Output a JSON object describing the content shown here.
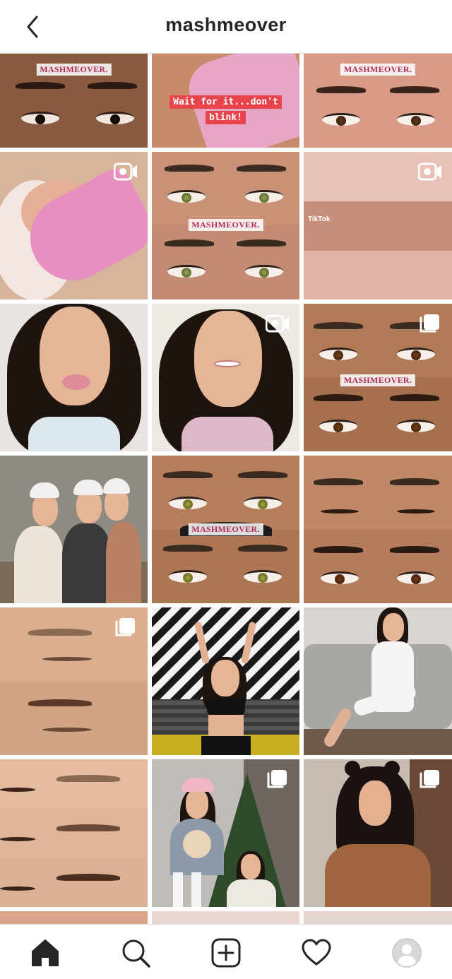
{
  "header": {
    "title": "mashmeover",
    "back_icon": "chevron-left-icon"
  },
  "watermark_text": "MASHMEOVER.",
  "grid": {
    "posts": [
      {
        "name": "post-1",
        "type": "photo",
        "watermark": true
      },
      {
        "name": "post-2",
        "type": "photo",
        "caption": "Wait for it...don't blink!"
      },
      {
        "name": "post-3",
        "type": "photo",
        "watermark": true
      },
      {
        "name": "post-4",
        "type": "video",
        "badge_icon": "video-camera-icon"
      },
      {
        "name": "post-5",
        "type": "photo",
        "watermark": true
      },
      {
        "name": "post-6",
        "type": "video",
        "badge_icon": "video-camera-icon",
        "overlay_text": "TikTok"
      },
      {
        "name": "post-7",
        "type": "photo"
      },
      {
        "name": "post-8",
        "type": "video",
        "badge_icon": "video-camera-icon"
      },
      {
        "name": "post-9",
        "type": "carousel",
        "badge_icon": "carousel-icon",
        "watermark": true
      },
      {
        "name": "post-10",
        "type": "photo"
      },
      {
        "name": "post-11",
        "type": "photo",
        "watermark": true
      },
      {
        "name": "post-12",
        "type": "photo"
      },
      {
        "name": "post-13",
        "type": "carousel",
        "badge_icon": "carousel-icon"
      },
      {
        "name": "post-14",
        "type": "photo"
      },
      {
        "name": "post-15",
        "type": "photo"
      },
      {
        "name": "post-16",
        "type": "photo"
      },
      {
        "name": "post-17",
        "type": "carousel",
        "badge_icon": "carousel-icon"
      },
      {
        "name": "post-18",
        "type": "carousel",
        "badge_icon": "carousel-icon"
      }
    ]
  },
  "bottom_nav": {
    "items": [
      {
        "name": "home",
        "icon": "home-icon"
      },
      {
        "name": "search",
        "icon": "search-icon"
      },
      {
        "name": "new-post",
        "icon": "plus-square-icon"
      },
      {
        "name": "activity",
        "icon": "heart-icon"
      },
      {
        "name": "profile",
        "icon": "avatar-icon"
      }
    ]
  },
  "colors": {
    "caption_bg": "#e9434c",
    "watermark_text": "#b02a5a",
    "divider": "#dbdbdb",
    "icon": "#262626"
  }
}
